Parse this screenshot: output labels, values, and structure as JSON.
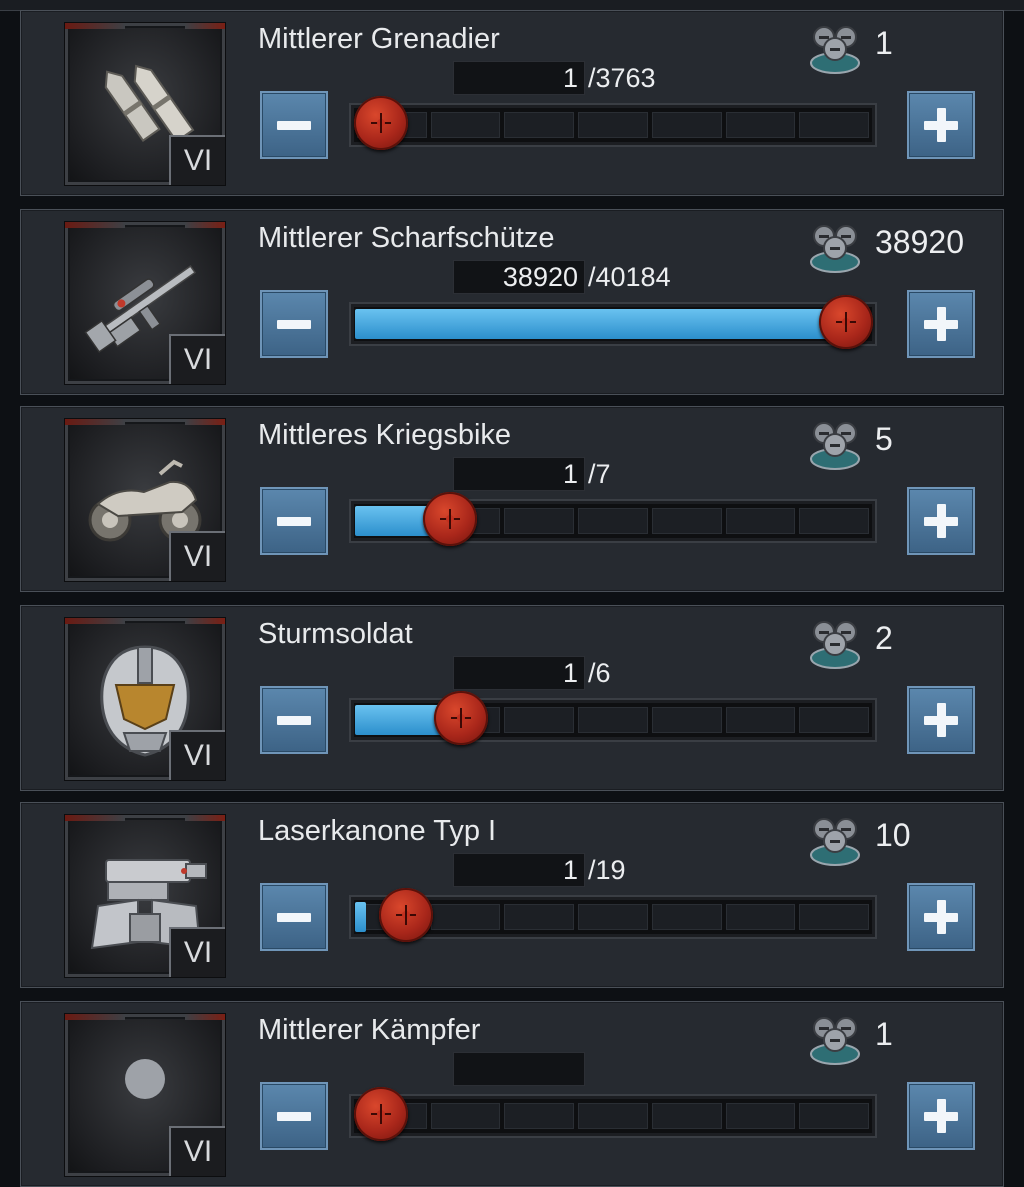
{
  "colors": {
    "panel_bg": "#262a30",
    "slider_fill": "#3fa6e0",
    "knob_red": "#c2301f",
    "button_blue": "#4a739a",
    "text": "#eceef0"
  },
  "units": [
    {
      "name": "Mittlerer Grenadier",
      "tier": "VI",
      "icon": "grenade-shells-icon",
      "owned": "1",
      "quantity": "1",
      "max_label": "/3763",
      "quantity_num": 1,
      "max_num": 3763
    },
    {
      "name": "Mittlerer Scharfschütze",
      "tier": "VI",
      "icon": "sniper-rifle-icon",
      "owned": "38920",
      "quantity": "38920",
      "max_label": "/40184",
      "quantity_num": 38920,
      "max_num": 40184
    },
    {
      "name": "Mittleres Kriegsbike",
      "tier": "VI",
      "icon": "motorbike-icon",
      "owned": "5",
      "quantity": "1",
      "max_label": "/7",
      "quantity_num": 1,
      "max_num": 7
    },
    {
      "name": "Sturmsoldat",
      "tier": "VI",
      "icon": "armored-helmet-icon",
      "owned": "2",
      "quantity": "1",
      "max_label": "/6",
      "quantity_num": 1,
      "max_num": 6
    },
    {
      "name": "Laserkanone Typ I",
      "tier": "VI",
      "icon": "laser-cannon-icon",
      "owned": "10",
      "quantity": "1",
      "max_label": "/19",
      "quantity_num": 1,
      "max_num": 19
    },
    {
      "name": "Mittlerer Kämpfer",
      "tier": "VI",
      "icon": "unit-icon",
      "owned": "1",
      "quantity": "",
      "max_label": "",
      "quantity_num": 0,
      "max_num": 1
    }
  ]
}
